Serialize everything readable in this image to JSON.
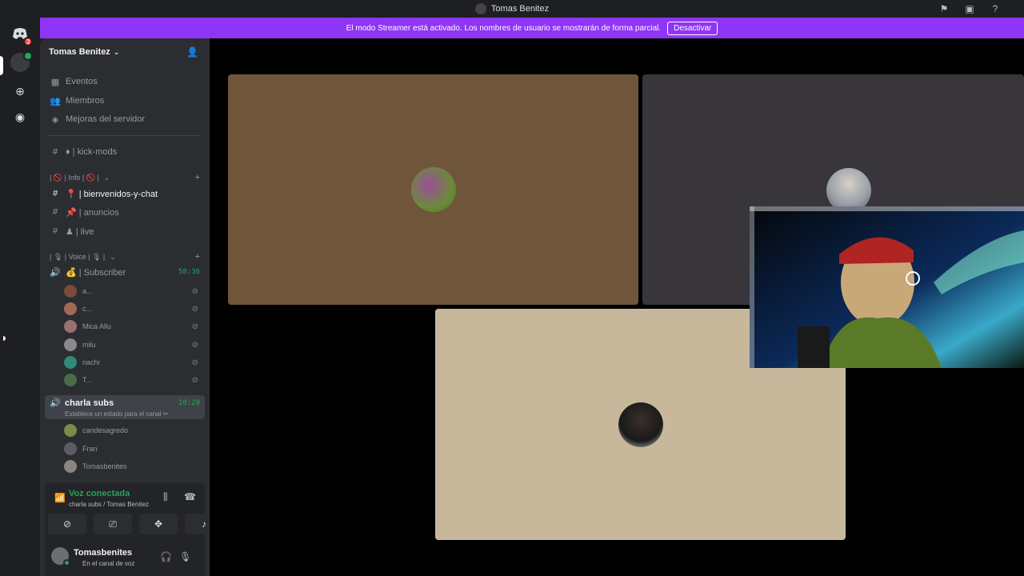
{
  "window": {
    "title": "Tomas Benitez"
  },
  "banner": {
    "text": "El modo Streamer está activado. Los nombres de usuario se mostrarán de forma parcial.",
    "button": "Desactivar"
  },
  "guilds": {
    "notifications": "3"
  },
  "server": {
    "name": "Tomas Benitez"
  },
  "nav": [
    {
      "label": "Eventos",
      "icon": "calendar-icon"
    },
    {
      "label": "Miembros",
      "icon": "members-icon"
    },
    {
      "label": "Mejoras del servidor",
      "icon": "boost-icon"
    }
  ],
  "channels": {
    "kick_mods": "♦ | kick-mods",
    "info_category": "| 🚫 | Info | 🚫 |",
    "bienvenidos": "📍 | bienvenidos-y-chat",
    "anuncios": "📌 | anuncios",
    "live": "♟ | live",
    "voice_category": "| 🎙 | Voice | 🎙 |",
    "subscriber": "💰 | Subscriber",
    "subscriber_time": "58:36",
    "charla": "charla subs",
    "charla_time": "10:20",
    "charla_status": "Establece un estado para el canal ✏"
  },
  "subscriber_members": [
    "a...",
    "c...",
    "Mica Allu",
    "milu",
    "nachi",
    "T..."
  ],
  "charla_members": [
    "candesagredo",
    "Fran",
    "Tomasbenites"
  ],
  "voice_panel": {
    "status": "Voz conectada",
    "location": "charla subs / Tomas Benitez"
  },
  "user": {
    "name": "Tomasbenites",
    "status": "En el canal de voz"
  },
  "colors": {
    "accent": "#8f35f5",
    "online": "#23a559",
    "tile1": "#6f5539",
    "tile2": "#38363b",
    "tile3": "#c8b89b"
  }
}
